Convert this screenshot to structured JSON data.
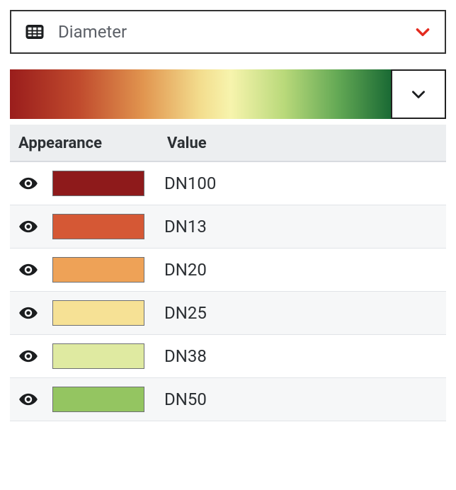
{
  "dropdown": {
    "label": "Diameter"
  },
  "table": {
    "headers": {
      "appearance": "Appearance",
      "value": "Value"
    },
    "rows": [
      {
        "color": "#8e1a1b",
        "value": "DN100"
      },
      {
        "color": "#d55835",
        "value": "DN13"
      },
      {
        "color": "#eea257",
        "value": "DN20"
      },
      {
        "color": "#f6e195",
        "value": "DN25"
      },
      {
        "color": "#dfeaa1",
        "value": "DN38"
      },
      {
        "color": "#94c561",
        "value": "DN50"
      }
    ]
  }
}
